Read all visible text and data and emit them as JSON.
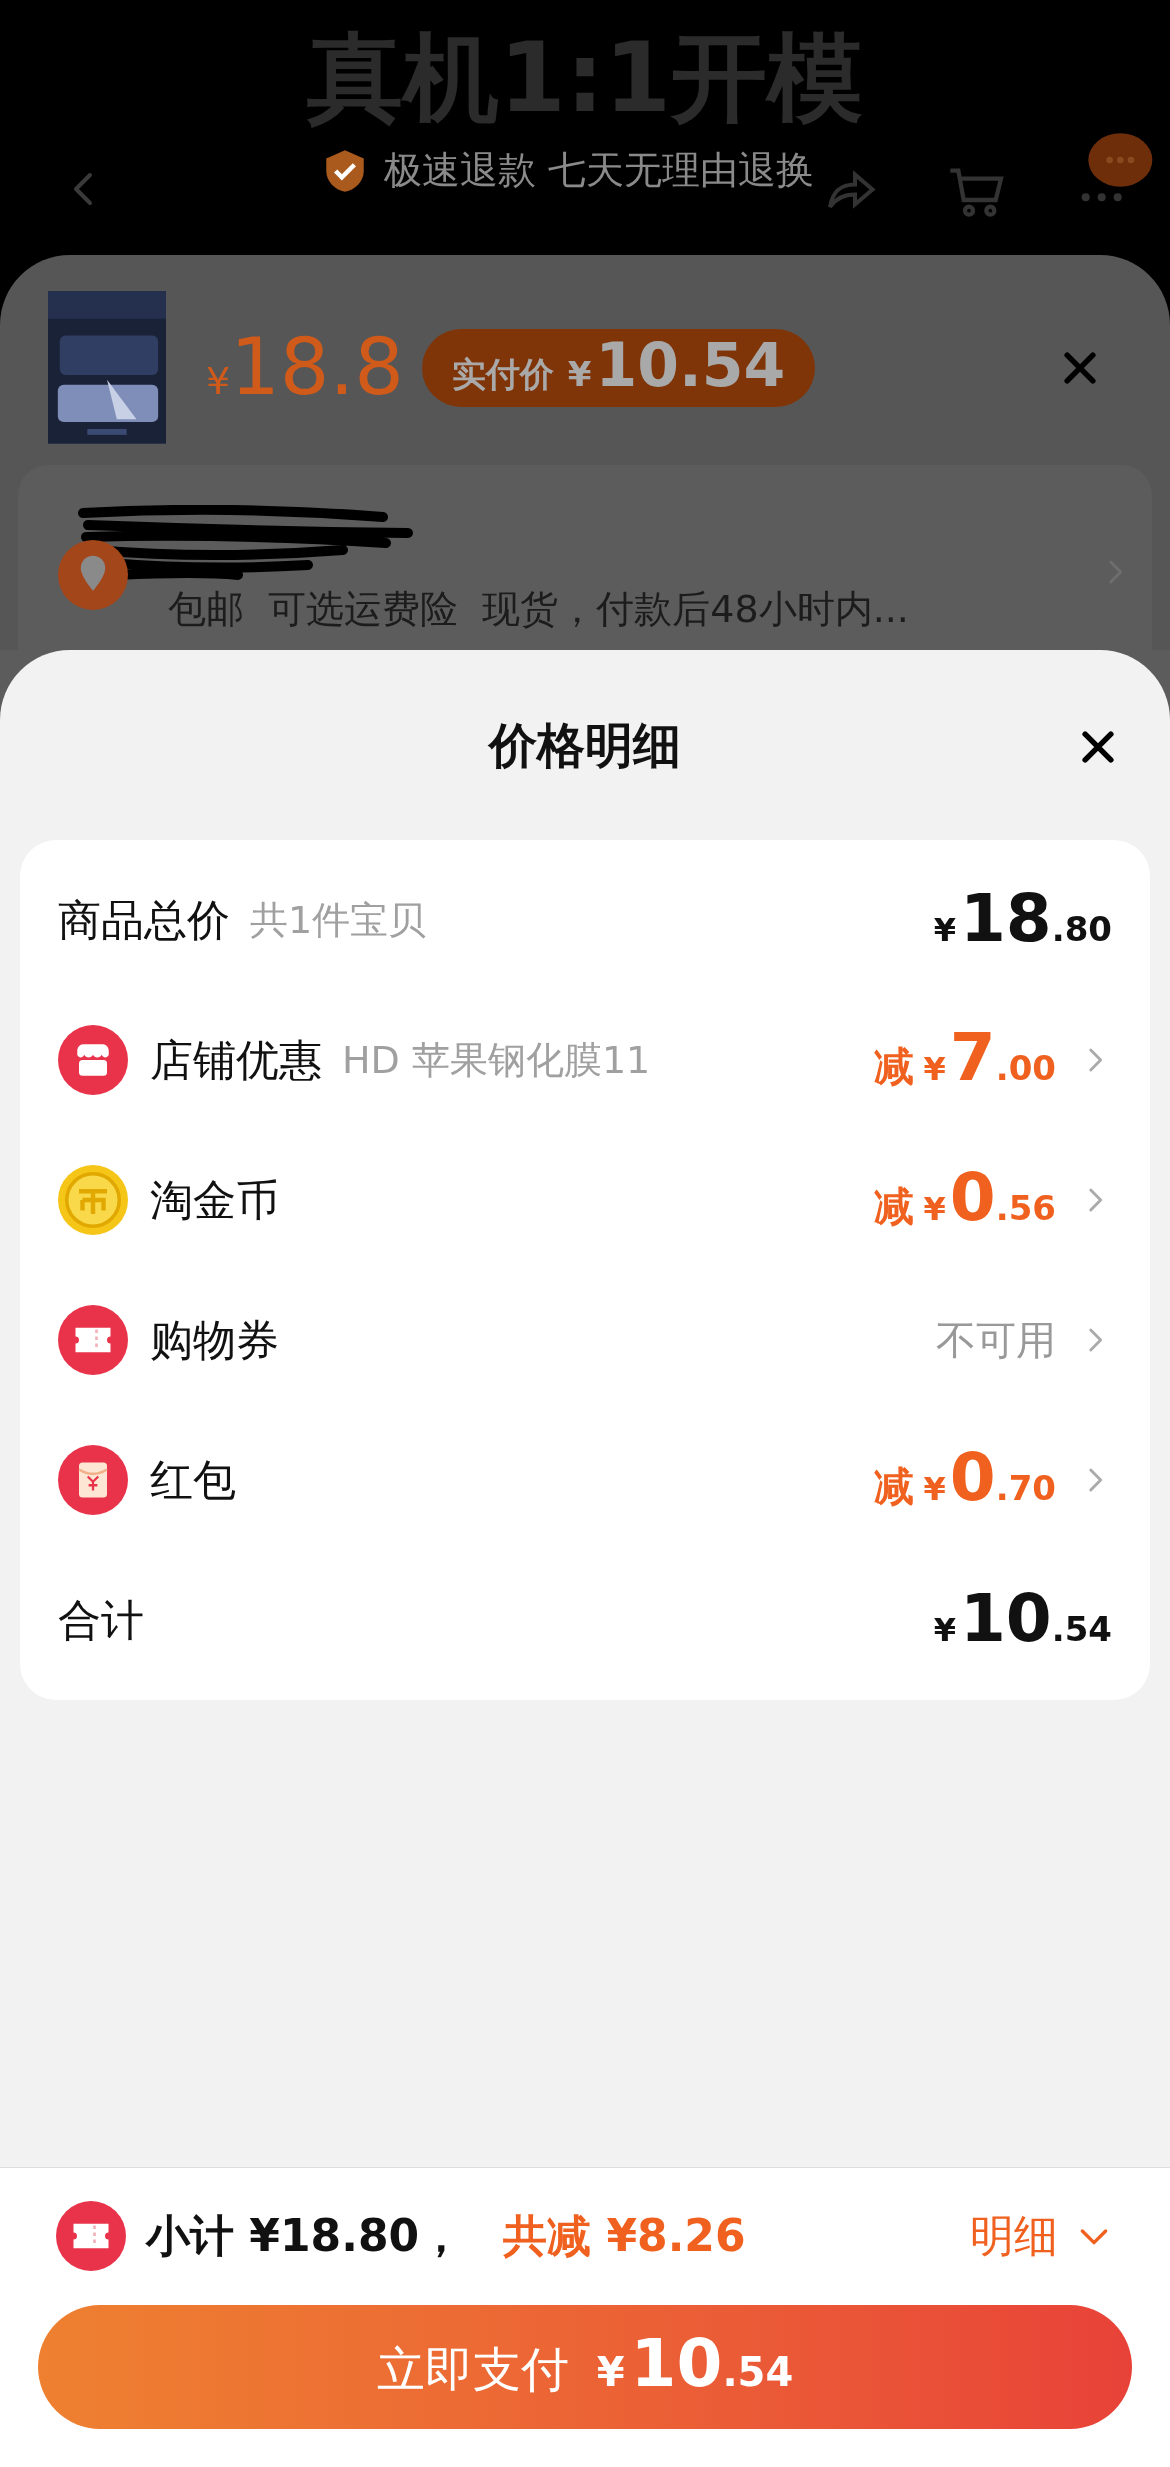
{
  "background_page": {
    "title": "真机1:1开模",
    "badge": "极速退款 七天无理由退换"
  },
  "product_sheet": {
    "price": {
      "currency": "¥",
      "amount": "18.8"
    },
    "paid_badge": {
      "label": "实付价",
      "currency": "¥",
      "amount": "10.54"
    },
    "shipping": {
      "text": "包邮  可选运费险  现货，付款后48小时内..."
    }
  },
  "price_detail": {
    "title": "价格明细",
    "rows": [
      {
        "kind": "total",
        "label": "商品总价",
        "note": "共1件宝贝",
        "currency": "¥",
        "integer": "18",
        "decimal": ".80"
      },
      {
        "kind": "discount",
        "label": "店铺优惠",
        "note": "HD 苹果钢化膜11",
        "prefix": "减",
        "currency": "¥",
        "integer": "7",
        "decimal": ".00"
      },
      {
        "kind": "discount",
        "label": "淘金币",
        "prefix": "减",
        "currency": "¥",
        "integer": "0",
        "decimal": ".56"
      },
      {
        "kind": "unavailable",
        "label": "购物券",
        "status": "不可用"
      },
      {
        "kind": "discount",
        "label": "红包",
        "prefix": "减",
        "currency": "¥",
        "integer": "0",
        "decimal": ".70"
      },
      {
        "kind": "sum",
        "label": "合计",
        "currency": "¥",
        "integer": "10",
        "decimal": ".54"
      }
    ]
  },
  "footer": {
    "subtotal": "小计 ¥18.80，",
    "reduction": "共减 ¥8.26",
    "detail_link": "明细",
    "pay_button": {
      "label": "立即支付",
      "currency": "¥",
      "integer": "10",
      "decimal": ".54"
    }
  }
}
